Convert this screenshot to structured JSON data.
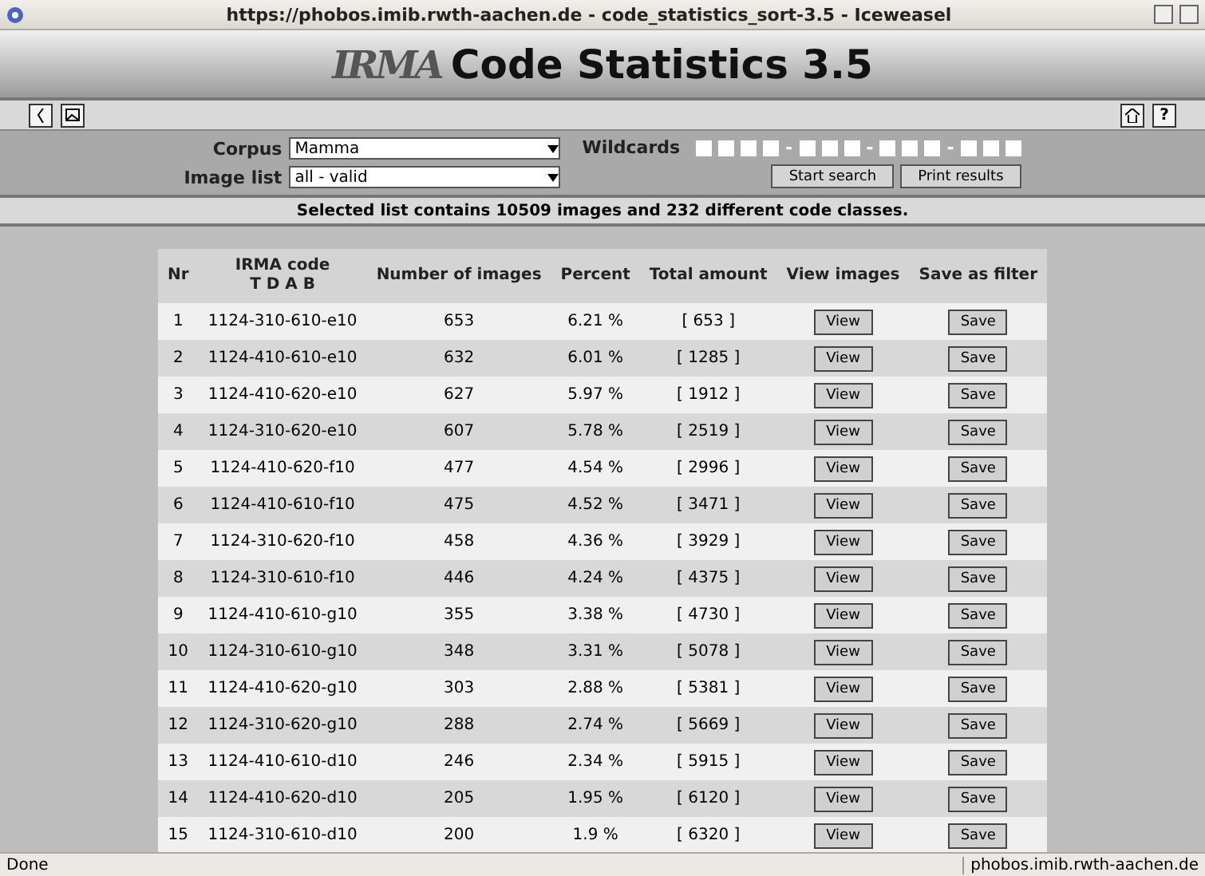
{
  "window": {
    "title": "https://phobos.imib.rwth-aachen.de - code_statistics_sort-3.5 - Iceweasel"
  },
  "header": {
    "logo": "IRMA",
    "title": "Code Statistics 3.5"
  },
  "toolbar": {
    "help": "?"
  },
  "form": {
    "corpus": {
      "label": "Corpus",
      "value": "Mamma"
    },
    "image_list": {
      "label": "Image list",
      "value": "all - valid"
    },
    "wildcards": {
      "label": "Wildcards",
      "separator": "-",
      "groups": [
        [
          {
            "checked": false
          },
          {
            "checked": false
          },
          {
            "checked": false
          },
          {
            "checked": false
          }
        ],
        [
          {
            "checked": false
          },
          {
            "checked": false
          },
          {
            "checked": false
          }
        ],
        [
          {
            "checked": false
          },
          {
            "checked": false
          },
          {
            "checked": false
          }
        ],
        [
          {
            "checked": false
          },
          {
            "checked": false
          },
          {
            "checked": false
          }
        ]
      ]
    },
    "buttons": [
      "Start search",
      "Print results"
    ]
  },
  "info": "Selected list contains 10509 images and 232 different code classes.",
  "table": {
    "columns": [
      {
        "label": "Nr"
      },
      {
        "label": "IRMA code",
        "sub": "T D A B"
      },
      {
        "label": "Number of images"
      },
      {
        "label": "Percent"
      },
      {
        "label": "Total amount"
      },
      {
        "label": "View images"
      },
      {
        "label": "Save as filter"
      }
    ],
    "rows": [
      {
        "cells": [
          "1",
          "1124-310-610-e10",
          "653",
          "6.21 %",
          "[ 653 ]"
        ],
        "view": "View",
        "save": "Save"
      },
      {
        "cells": [
          "2",
          "1124-410-610-e10",
          "632",
          "6.01 %",
          "[ 1285 ]"
        ],
        "view": "View",
        "save": "Save"
      },
      {
        "cells": [
          "3",
          "1124-410-620-e10",
          "627",
          "5.97 %",
          "[ 1912 ]"
        ],
        "view": "View",
        "save": "Save"
      },
      {
        "cells": [
          "4",
          "1124-310-620-e10",
          "607",
          "5.78 %",
          "[ 2519 ]"
        ],
        "view": "View",
        "save": "Save"
      },
      {
        "cells": [
          "5",
          "1124-410-620-f10",
          "477",
          "4.54 %",
          "[ 2996 ]"
        ],
        "view": "View",
        "save": "Save"
      },
      {
        "cells": [
          "6",
          "1124-410-610-f10",
          "475",
          "4.52 %",
          "[ 3471 ]"
        ],
        "view": "View",
        "save": "Save"
      },
      {
        "cells": [
          "7",
          "1124-310-620-f10",
          "458",
          "4.36 %",
          "[ 3929 ]"
        ],
        "view": "View",
        "save": "Save"
      },
      {
        "cells": [
          "8",
          "1124-310-610-f10",
          "446",
          "4.24 %",
          "[ 4375 ]"
        ],
        "view": "View",
        "save": "Save"
      },
      {
        "cells": [
          "9",
          "1124-410-610-g10",
          "355",
          "3.38 %",
          "[ 4730 ]"
        ],
        "view": "View",
        "save": "Save"
      },
      {
        "cells": [
          "10",
          "1124-310-610-g10",
          "348",
          "3.31 %",
          "[ 5078 ]"
        ],
        "view": "View",
        "save": "Save"
      },
      {
        "cells": [
          "11",
          "1124-410-620-g10",
          "303",
          "2.88 %",
          "[ 5381 ]"
        ],
        "view": "View",
        "save": "Save"
      },
      {
        "cells": [
          "12",
          "1124-310-620-g10",
          "288",
          "2.74 %",
          "[ 5669 ]"
        ],
        "view": "View",
        "save": "Save"
      },
      {
        "cells": [
          "13",
          "1124-410-610-d10",
          "246",
          "2.34 %",
          "[ 5915 ]"
        ],
        "view": "View",
        "save": "Save"
      },
      {
        "cells": [
          "14",
          "1124-410-620-d10",
          "205",
          "1.95 %",
          "[ 6120 ]"
        ],
        "view": "View",
        "save": "Save"
      },
      {
        "cells": [
          "15",
          "1124-310-610-d10",
          "200",
          "1.9 %",
          "[ 6320 ]"
        ],
        "view": "View",
        "save": "Save"
      }
    ]
  },
  "status_bar": {
    "left": "Done",
    "right": "phobos.imib.rwth-aachen.de"
  }
}
